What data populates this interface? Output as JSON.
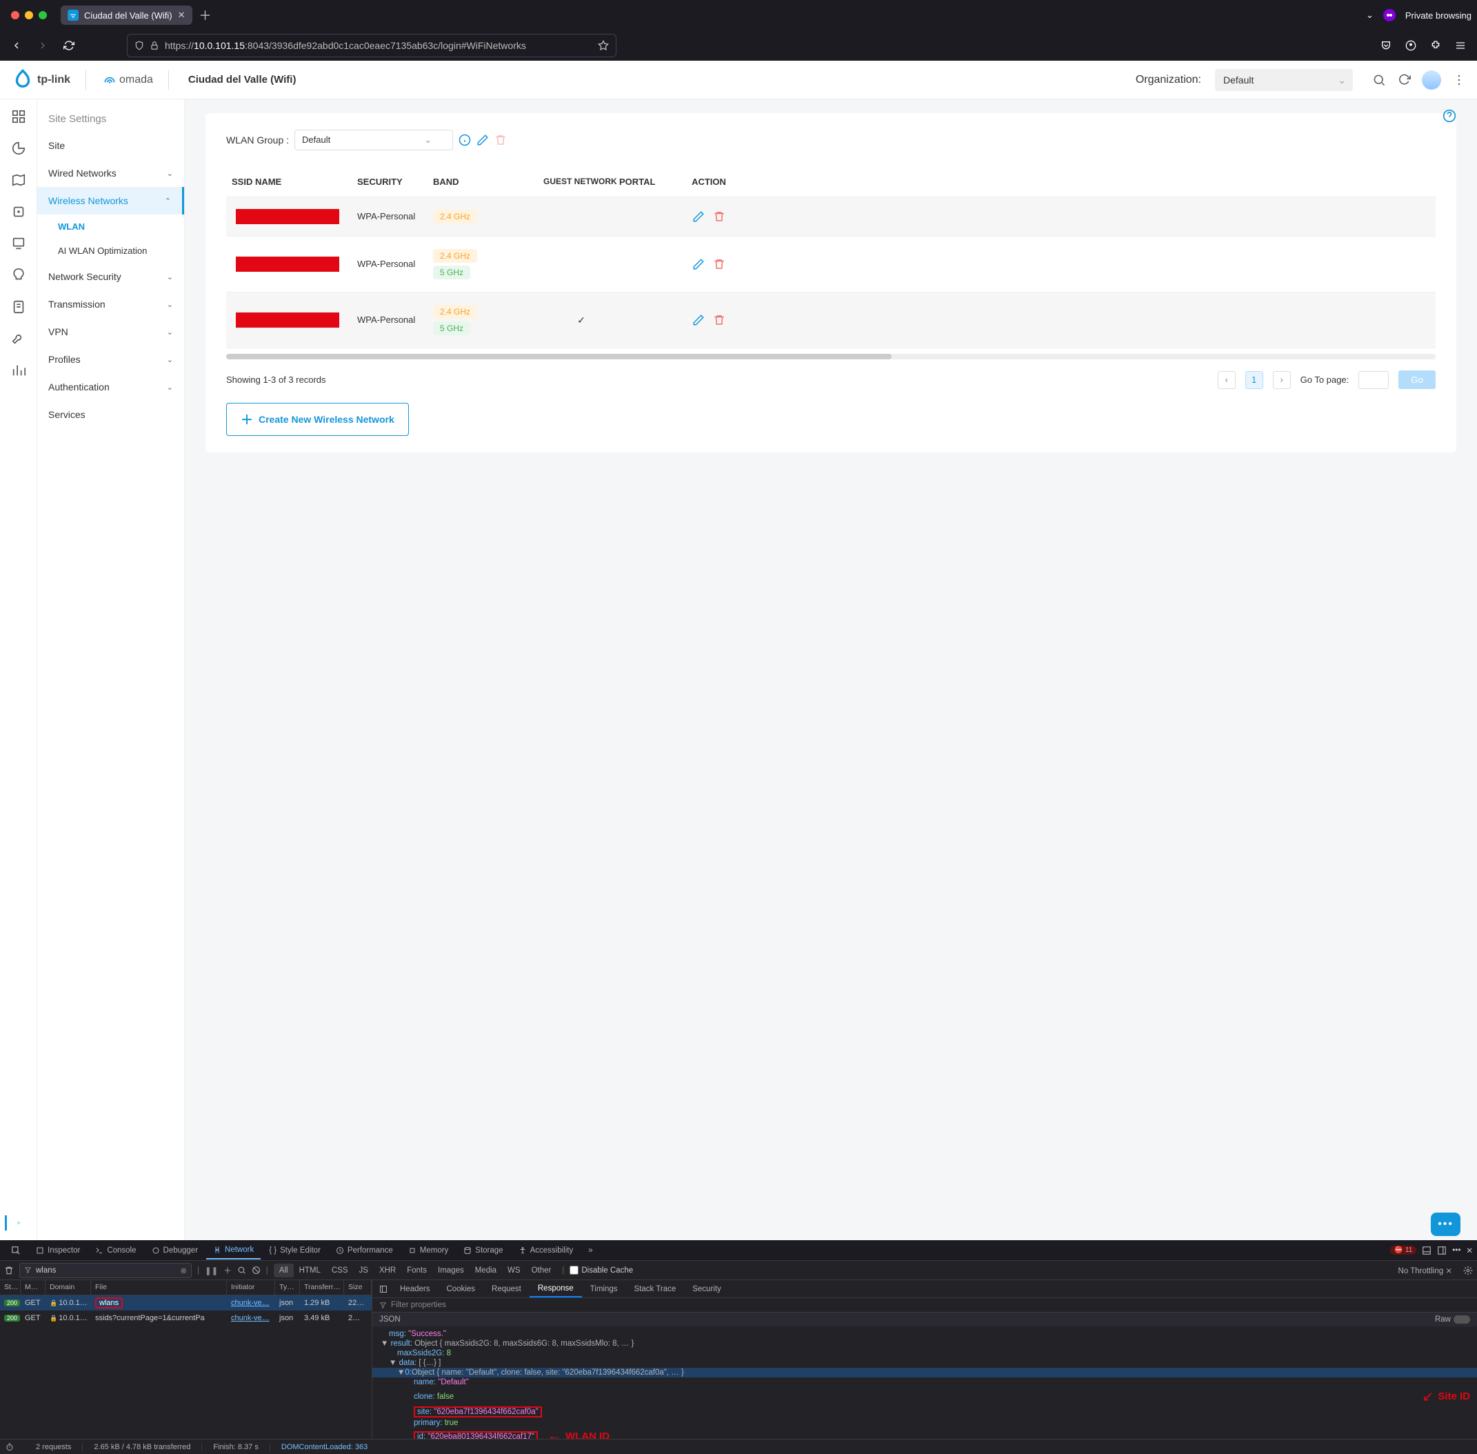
{
  "browser": {
    "tab_title": "Ciudad del Valle (Wifi)",
    "private_label": "Private browsing",
    "url_prefix": "https://",
    "url_host": "10.0.101.15",
    "url_port": ":8043",
    "url_path": "/3936dfe92abd0c1cac0eaec7135ab63c/login#WiFiNetworks"
  },
  "app": {
    "brand1": "tp-link",
    "brand2": "omada",
    "site_name": "Ciudad del Valle (Wifi)",
    "org_label": "Organization:",
    "org_value": "Default"
  },
  "sidebar": {
    "header": "Site Settings",
    "items": {
      "site": "Site",
      "wired": "Wired Networks",
      "wireless": "Wireless Networks",
      "wlan": "WLAN",
      "ai_opt": "AI WLAN Optimization",
      "netsec": "Network Security",
      "trans": "Transmission",
      "vpn": "VPN",
      "profiles": "Profiles",
      "auth": "Authentication",
      "services": "Services"
    }
  },
  "wlan": {
    "group_label": "WLAN Group :",
    "group_value": "Default",
    "headers": {
      "ssid": "SSID NAME",
      "sec": "SECURITY",
      "band": "BAND",
      "guest": "GUEST NETWORK",
      "portal": "PORTAL",
      "action": "ACTION"
    },
    "sec_text": "WPA-Personal",
    "band24": "2.4 GHz",
    "band5": "5 GHz",
    "showing": "Showing 1-3 of 3 records",
    "page": "1",
    "goto_label": "Go To page:",
    "go_btn": "Go",
    "create_btn": "Create New Wireless Network"
  },
  "devtools": {
    "tabs": {
      "inspector": "Inspector",
      "console": "Console",
      "debugger": "Debugger",
      "network": "Network",
      "style": "Style Editor",
      "perf": "Performance",
      "memory": "Memory",
      "storage": "Storage",
      "a11y": "Accessibility"
    },
    "err_count": "11",
    "filter_value": "wlans",
    "chips": {
      "all": "All",
      "html": "HTML",
      "css": "CSS",
      "js": "JS",
      "xhr": "XHR",
      "fonts": "Fonts",
      "images": "Images",
      "media": "Media",
      "ws": "WS",
      "other": "Other"
    },
    "disable_cache": "Disable Cache",
    "throttle": "No Throttling",
    "cols": {
      "st": "St…",
      "m": "M…",
      "dom": "Domain",
      "file": "File",
      "init": "Initiator",
      "ty": "Ty…",
      "tr": "Transferr…",
      "sz": "Size"
    },
    "rows": [
      {
        "status": "200",
        "method": "GET",
        "domain": "10.0.1…",
        "file": "wlans",
        "initiator": "chunk-ve…",
        "type": "json",
        "transferred": "1.29 kB",
        "size": "22…"
      },
      {
        "status": "200",
        "method": "GET",
        "domain": "10.0.1…",
        "file": "ssids?currentPage=1&currentPa",
        "initiator": "chunk-ve…",
        "type": "json",
        "transferred": "3.49 kB",
        "size": "2…"
      }
    ],
    "r_tabs": {
      "headers": "Headers",
      "cookies": "Cookies",
      "request": "Request",
      "response": "Response",
      "timings": "Timings",
      "stack": "Stack Trace",
      "security": "Security"
    },
    "filter_props": "Filter properties",
    "json_label": "JSON",
    "raw_label": "Raw",
    "json": {
      "msg_k": "msg:",
      "msg_v": "\"Success.\"",
      "result_k": "result:",
      "result_sum": "Object { maxSsids2G: 8, maxSsids6G: 8, maxSsidsMlo: 8, … }",
      "max2g_k": "maxSsids2G:",
      "max2g_v": "8",
      "data_k": "data:",
      "data_sum": "[ {…} ]",
      "obj0_k": "0:",
      "obj0_sum": "Object { name: \"Default\", clone: false, site: \"620eba7f1396434f662caf0a\", … }",
      "name_k": "name:",
      "name_v": "\"Default\"",
      "clone_k": "clone:",
      "clone_v": "false",
      "site_k": "site:",
      "site_v": "\"620eba7f1396434f662caf0a\"",
      "primary_k": "primary:",
      "primary_v": "true",
      "id_k": "id:",
      "id_v": "\"620eba801396434f662caf17\"",
      "max6g_k": "maxSsids6G:",
      "max6g_v": "8"
    },
    "anno": {
      "site_id": "Site ID",
      "wlan_id": "WLAN ID"
    },
    "status": {
      "req": "2 requests",
      "kb": "2.65 kB / 4.78 kB transferred",
      "finish": "Finish: 8.37 s",
      "dom": "DOMContentLoaded: 363"
    }
  }
}
